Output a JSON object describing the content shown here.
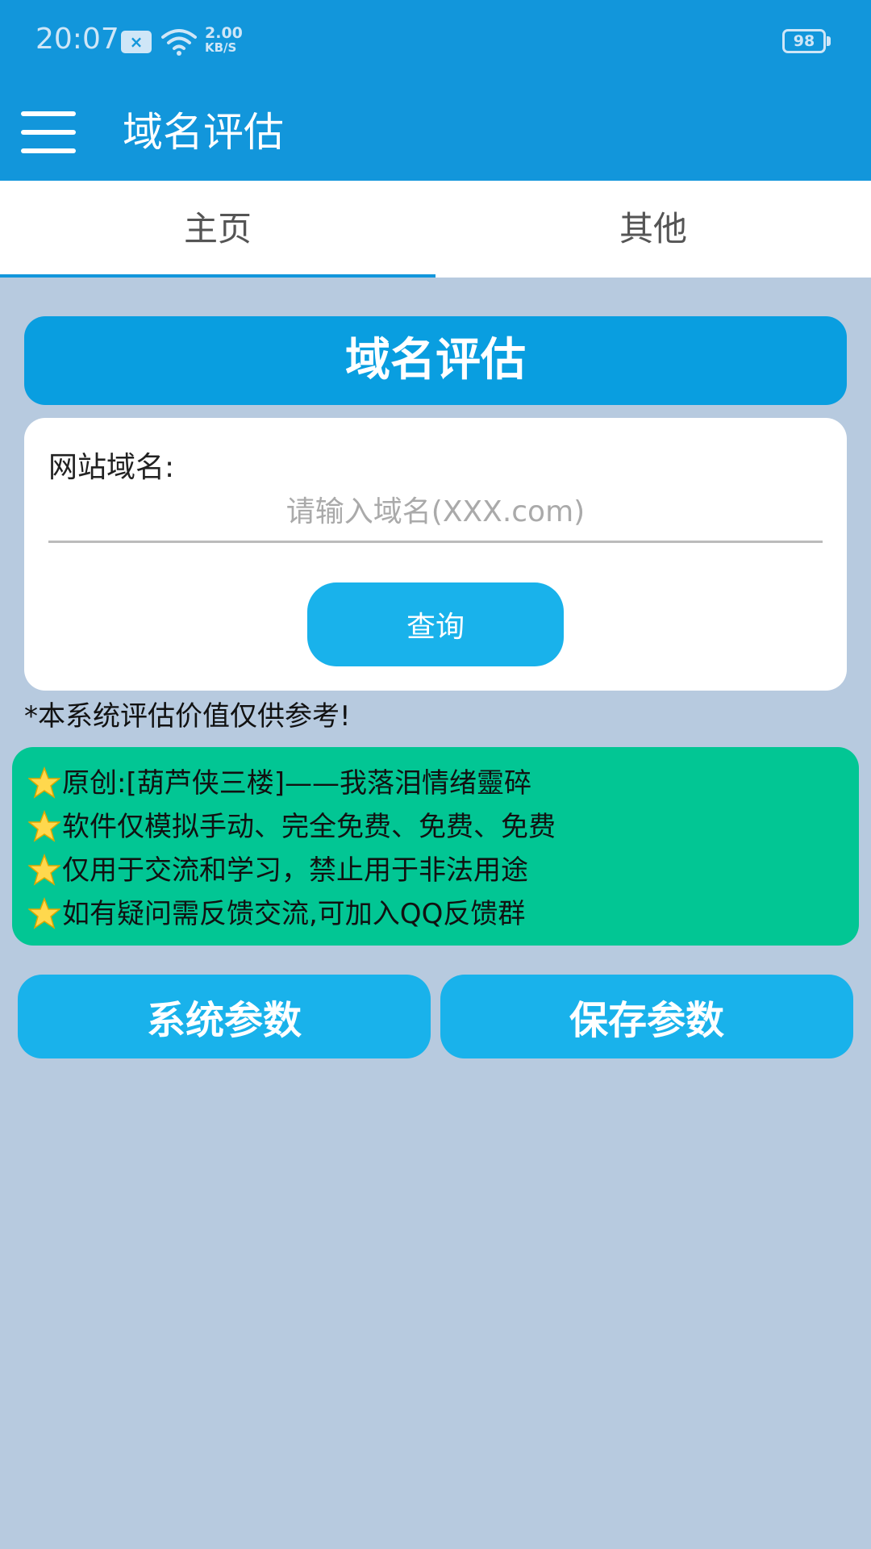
{
  "status_bar": {
    "time": "20:07",
    "net_speed_value": "2.00",
    "net_speed_unit": "KB/S",
    "battery": "98",
    "icons": [
      "sim-card-icon",
      "wifi-icon",
      "battery-icon"
    ]
  },
  "app_bar": {
    "title": "域名评估",
    "menu_icon": "hamburger-menu-icon"
  },
  "tabs": [
    {
      "label": "主页",
      "active": true
    },
    {
      "label": "其他",
      "active": false
    }
  ],
  "main": {
    "banner": "域名评估",
    "domain_label": "网站域名:",
    "domain_input": {
      "value": "",
      "placeholder": "请输入域名(XXX.com)"
    },
    "query_button": "查询",
    "disclaimer": "*本系统评估价值仅供参考!"
  },
  "info": {
    "icon": "star-icon",
    "lines": [
      "原创:[葫芦侠三楼]——我落泪情绪靈碎",
      "软件仅模拟手动、完全免费、免费、免费",
      "仅用于交流和学习，禁止用于非法用途",
      "如有疑问需反馈交流,可加入QQ反馈群"
    ]
  },
  "actions": {
    "system_params": "系统参数",
    "save_params": "保存参数"
  },
  "colors": {
    "primary": "#1296db",
    "button": "#19b2eb",
    "info_bg": "#02c694",
    "background": "#b7cadf"
  }
}
